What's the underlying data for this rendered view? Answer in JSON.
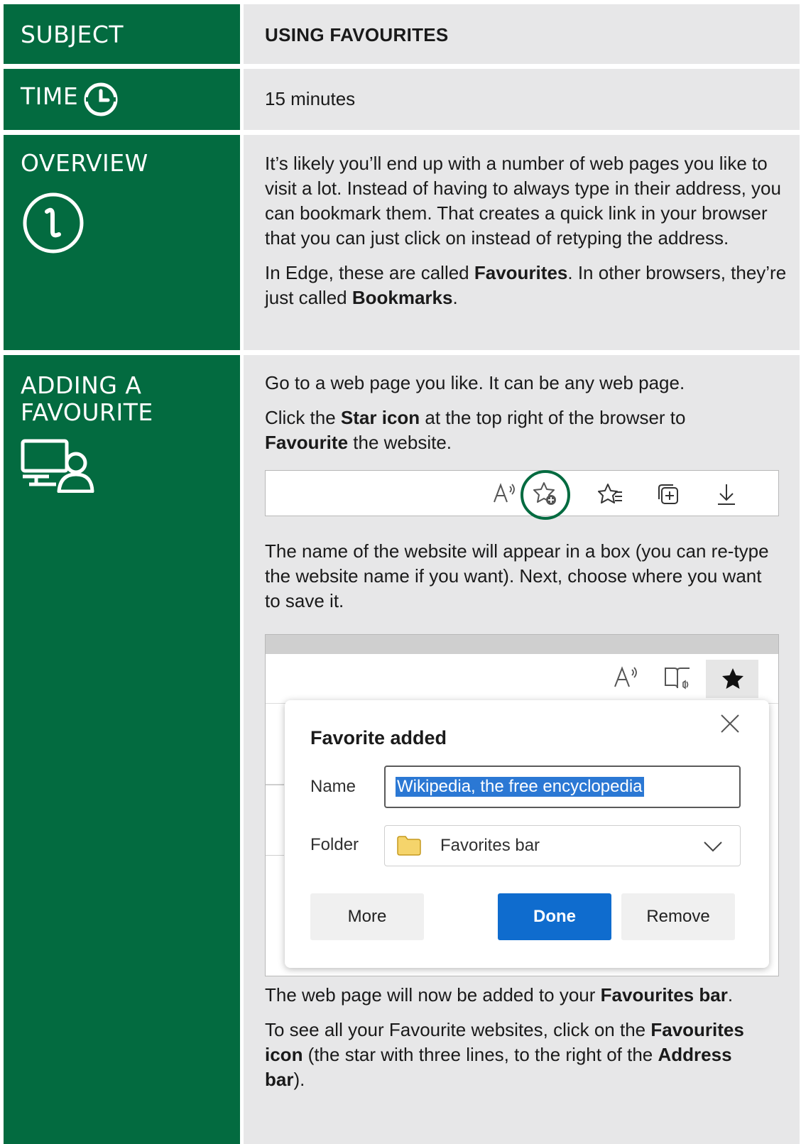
{
  "subject": {
    "label": "SUBJECT",
    "value": "USING FAVOURITES"
  },
  "time": {
    "label": "TIME",
    "value": "15 minutes"
  },
  "overview": {
    "label": "OVERVIEW",
    "p1": "It’s likely you’ll end up with a number of web pages you like to visit a lot. Instead of having to always type in their address, you can bookmark them. That creates a quick link in your browser that you can just click on instead of retyping the address.",
    "p2_a": "In Edge, these are called ",
    "p2_b": "Favourites",
    "p2_c": ". In other browsers, they’re just called ",
    "p2_d": "Bookmarks",
    "p2_e": "."
  },
  "adding": {
    "label_line1": "ADDING A",
    "label_line2": "FAVOURITE",
    "p1": "Go to a web page you like. It can be any web page.",
    "p2_a": "Click the ",
    "p2_b": "Star icon",
    "p2_c": " at the top right of the browser to ",
    "p2_d": "Favourite",
    "p2_e": " the website.",
    "p3": "The name of the website will appear in a box (you can re-type the website name if you want). Next, choose where you want to save it.",
    "p4_a": "The web page will now be added to your ",
    "p4_b": "Favourites bar",
    "p4_c": ".",
    "p5_a": "To see all your Favourite websites, click on the ",
    "p5_b": "Favourites icon",
    "p5_c": " (the star with three lines, to the right of the ",
    "p5_d": "Address bar",
    "p5_e": ")."
  },
  "dialog": {
    "title": "Favorite added",
    "name_label": "Name",
    "name_value": "Wikipedia, the free encyclopedia",
    "folder_label": "Folder",
    "folder_value": "Favorites bar",
    "more": "More",
    "done": "Done",
    "remove": "Remove"
  },
  "colors": {
    "green": "#036b40",
    "panel": "#e7e7e8",
    "done_blue": "#0f6cce"
  }
}
